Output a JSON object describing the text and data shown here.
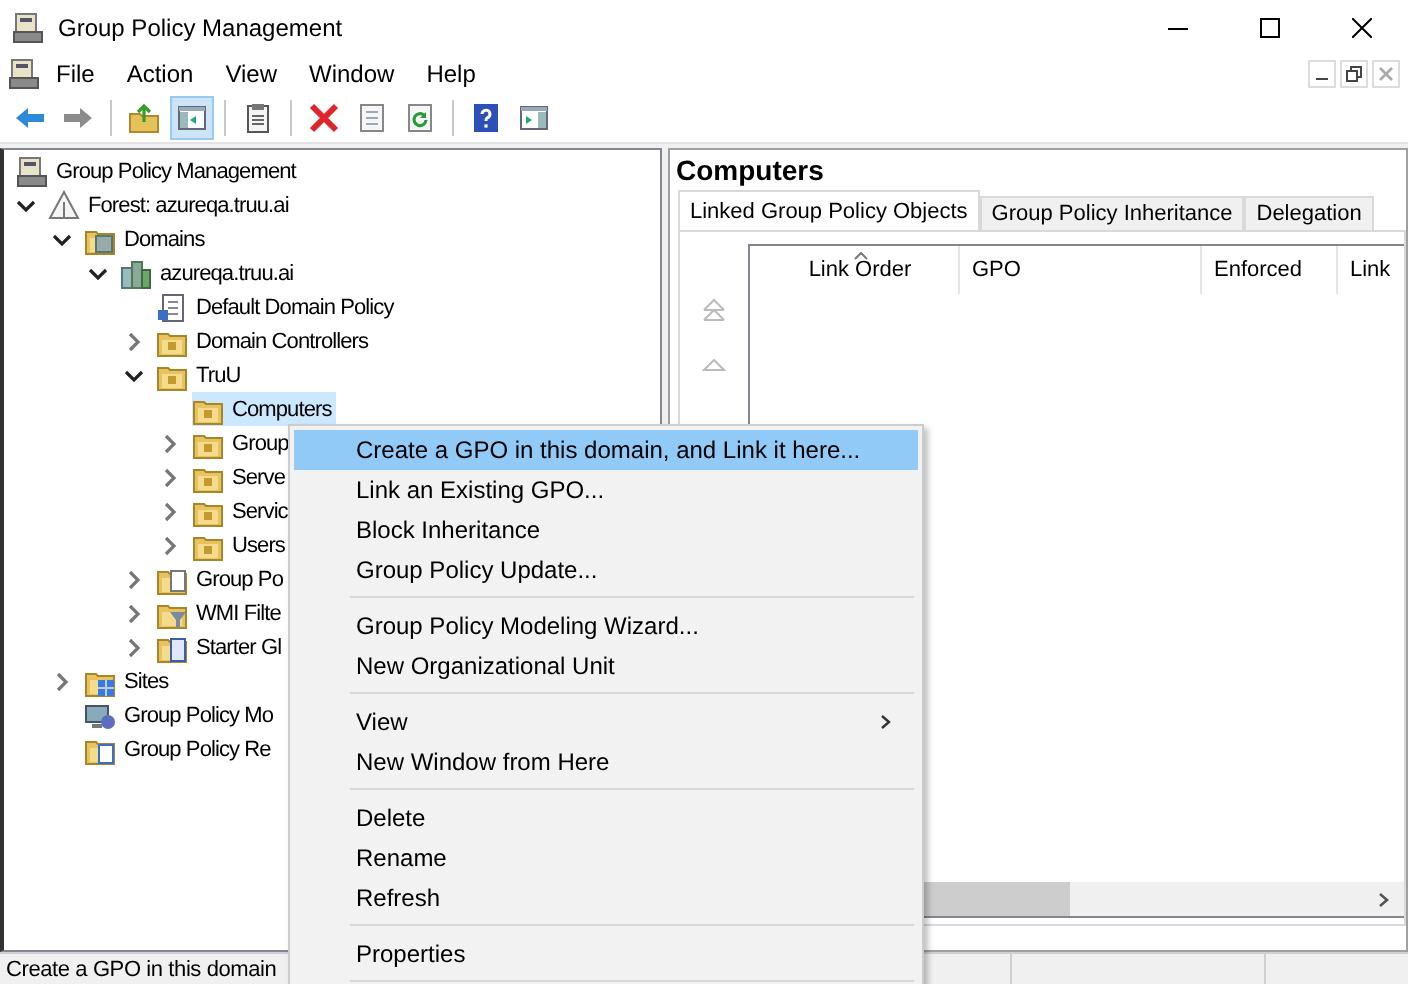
{
  "window": {
    "title": "Group Policy Management"
  },
  "menu_bar": [
    "File",
    "Action",
    "View",
    "Window",
    "Help"
  ],
  "toolbar": [
    {
      "kind": "button",
      "pressed": false
    },
    {
      "kind": "button",
      "pressed": false
    },
    {
      "kind": "separator"
    },
    {
      "kind": "button",
      "pressed": false
    },
    {
      "kind": "button",
      "pressed": true
    },
    {
      "kind": "separator"
    },
    {
      "kind": "button",
      "pressed": false
    },
    {
      "kind": "separator"
    },
    {
      "kind": "button",
      "pressed": false
    },
    {
      "kind": "button",
      "pressed": false
    },
    {
      "kind": "button",
      "pressed": false
    },
    {
      "kind": "separator"
    },
    {
      "kind": "button",
      "pressed": false
    },
    {
      "kind": "button",
      "pressed": false
    }
  ],
  "tree": [
    {
      "label": "Group Policy Management",
      "kind": "console",
      "selected": false,
      "children": [
        {
          "label": "Forest: azureqa.truu.ai",
          "kind": "forest",
          "expanded": true,
          "selected": false,
          "children": [
            {
              "label": "Domains",
              "kind": "domains",
              "expanded": true,
              "selected": false,
              "children": [
                {
                  "label": "azureqa.truu.ai",
                  "kind": "domain",
                  "expanded": true,
                  "selected": false,
                  "children": [
                    {
                      "label": "Default Domain Policy",
                      "kind": "gpo",
                      "selected": false
                    },
                    {
                      "label": "Domain Controllers",
                      "kind": "ou",
                      "expanded": false,
                      "selected": false
                    },
                    {
                      "label": "TruU",
                      "kind": "ou",
                      "expanded": true,
                      "selected": false,
                      "children": [
                        {
                          "label": "Computers",
                          "kind": "ou",
                          "selected": true
                        },
                        {
                          "label": "Group",
                          "kind": "ou",
                          "expanded": false,
                          "selected": false
                        },
                        {
                          "label": "Serve",
                          "kind": "ou",
                          "expanded": false,
                          "selected": false
                        },
                        {
                          "label": "Servic",
                          "kind": "ou",
                          "expanded": false,
                          "selected": false
                        },
                        {
                          "label": "Users",
                          "kind": "ou",
                          "expanded": false,
                          "selected": false
                        }
                      ]
                    },
                    {
                      "label": "Group Po",
                      "kind": "gpos",
                      "expanded": false,
                      "selected": false
                    },
                    {
                      "label": "WMI Filte",
                      "kind": "wmi",
                      "expanded": false,
                      "selected": false
                    },
                    {
                      "label": "Starter Gl",
                      "kind": "starter",
                      "expanded": false,
                      "selected": false
                    }
                  ]
                }
              ]
            },
            {
              "label": "Sites",
              "kind": "sites",
              "expanded": false,
              "selected": false
            },
            {
              "label": "Group Policy Mo",
              "kind": "modeling",
              "selected": false
            },
            {
              "label": "Group Policy Re",
              "kind": "results",
              "selected": false
            }
          ]
        }
      ]
    }
  ],
  "details": {
    "title": "Computers",
    "tabs": [
      {
        "label": "Linked Group Policy Objects",
        "selected": true
      },
      {
        "label": "Group Policy Inheritance",
        "selected": false
      },
      {
        "label": "Delegation",
        "selected": false
      }
    ],
    "columns": [
      {
        "label": "Link Order",
        "sorted": true
      },
      {
        "label": "GPO",
        "sorted": false
      },
      {
        "label": "Enforced",
        "sorted": false
      },
      {
        "label": "Link",
        "sorted": false
      }
    ]
  },
  "context_menu": [
    {
      "kind": "item",
      "label": "Create a GPO in this domain, and Link it here...",
      "selected": true,
      "submenu": false
    },
    {
      "kind": "item",
      "label": "Link an Existing GPO...",
      "selected": false,
      "submenu": false
    },
    {
      "kind": "item",
      "label": "Block Inheritance",
      "selected": false,
      "submenu": false
    },
    {
      "kind": "item",
      "label": "Group Policy Update...",
      "selected": false,
      "submenu": false
    },
    {
      "kind": "separator"
    },
    {
      "kind": "item",
      "label": "Group Policy Modeling Wizard...",
      "selected": false,
      "submenu": false
    },
    {
      "kind": "item",
      "label": "New Organizational Unit",
      "selected": false,
      "submenu": false
    },
    {
      "kind": "separator"
    },
    {
      "kind": "item",
      "label": "View",
      "selected": false,
      "submenu": true
    },
    {
      "kind": "item",
      "label": "New Window from Here",
      "selected": false,
      "submenu": false
    },
    {
      "kind": "separator"
    },
    {
      "kind": "item",
      "label": "Delete",
      "selected": false,
      "submenu": false
    },
    {
      "kind": "item",
      "label": "Rename",
      "selected": false,
      "submenu": false
    },
    {
      "kind": "item",
      "label": "Refresh",
      "selected": false,
      "submenu": false
    },
    {
      "kind": "separator"
    },
    {
      "kind": "item",
      "label": "Properties",
      "selected": false,
      "submenu": false
    },
    {
      "kind": "separator"
    }
  ],
  "status_bar": "Create a GPO in this domain"
}
